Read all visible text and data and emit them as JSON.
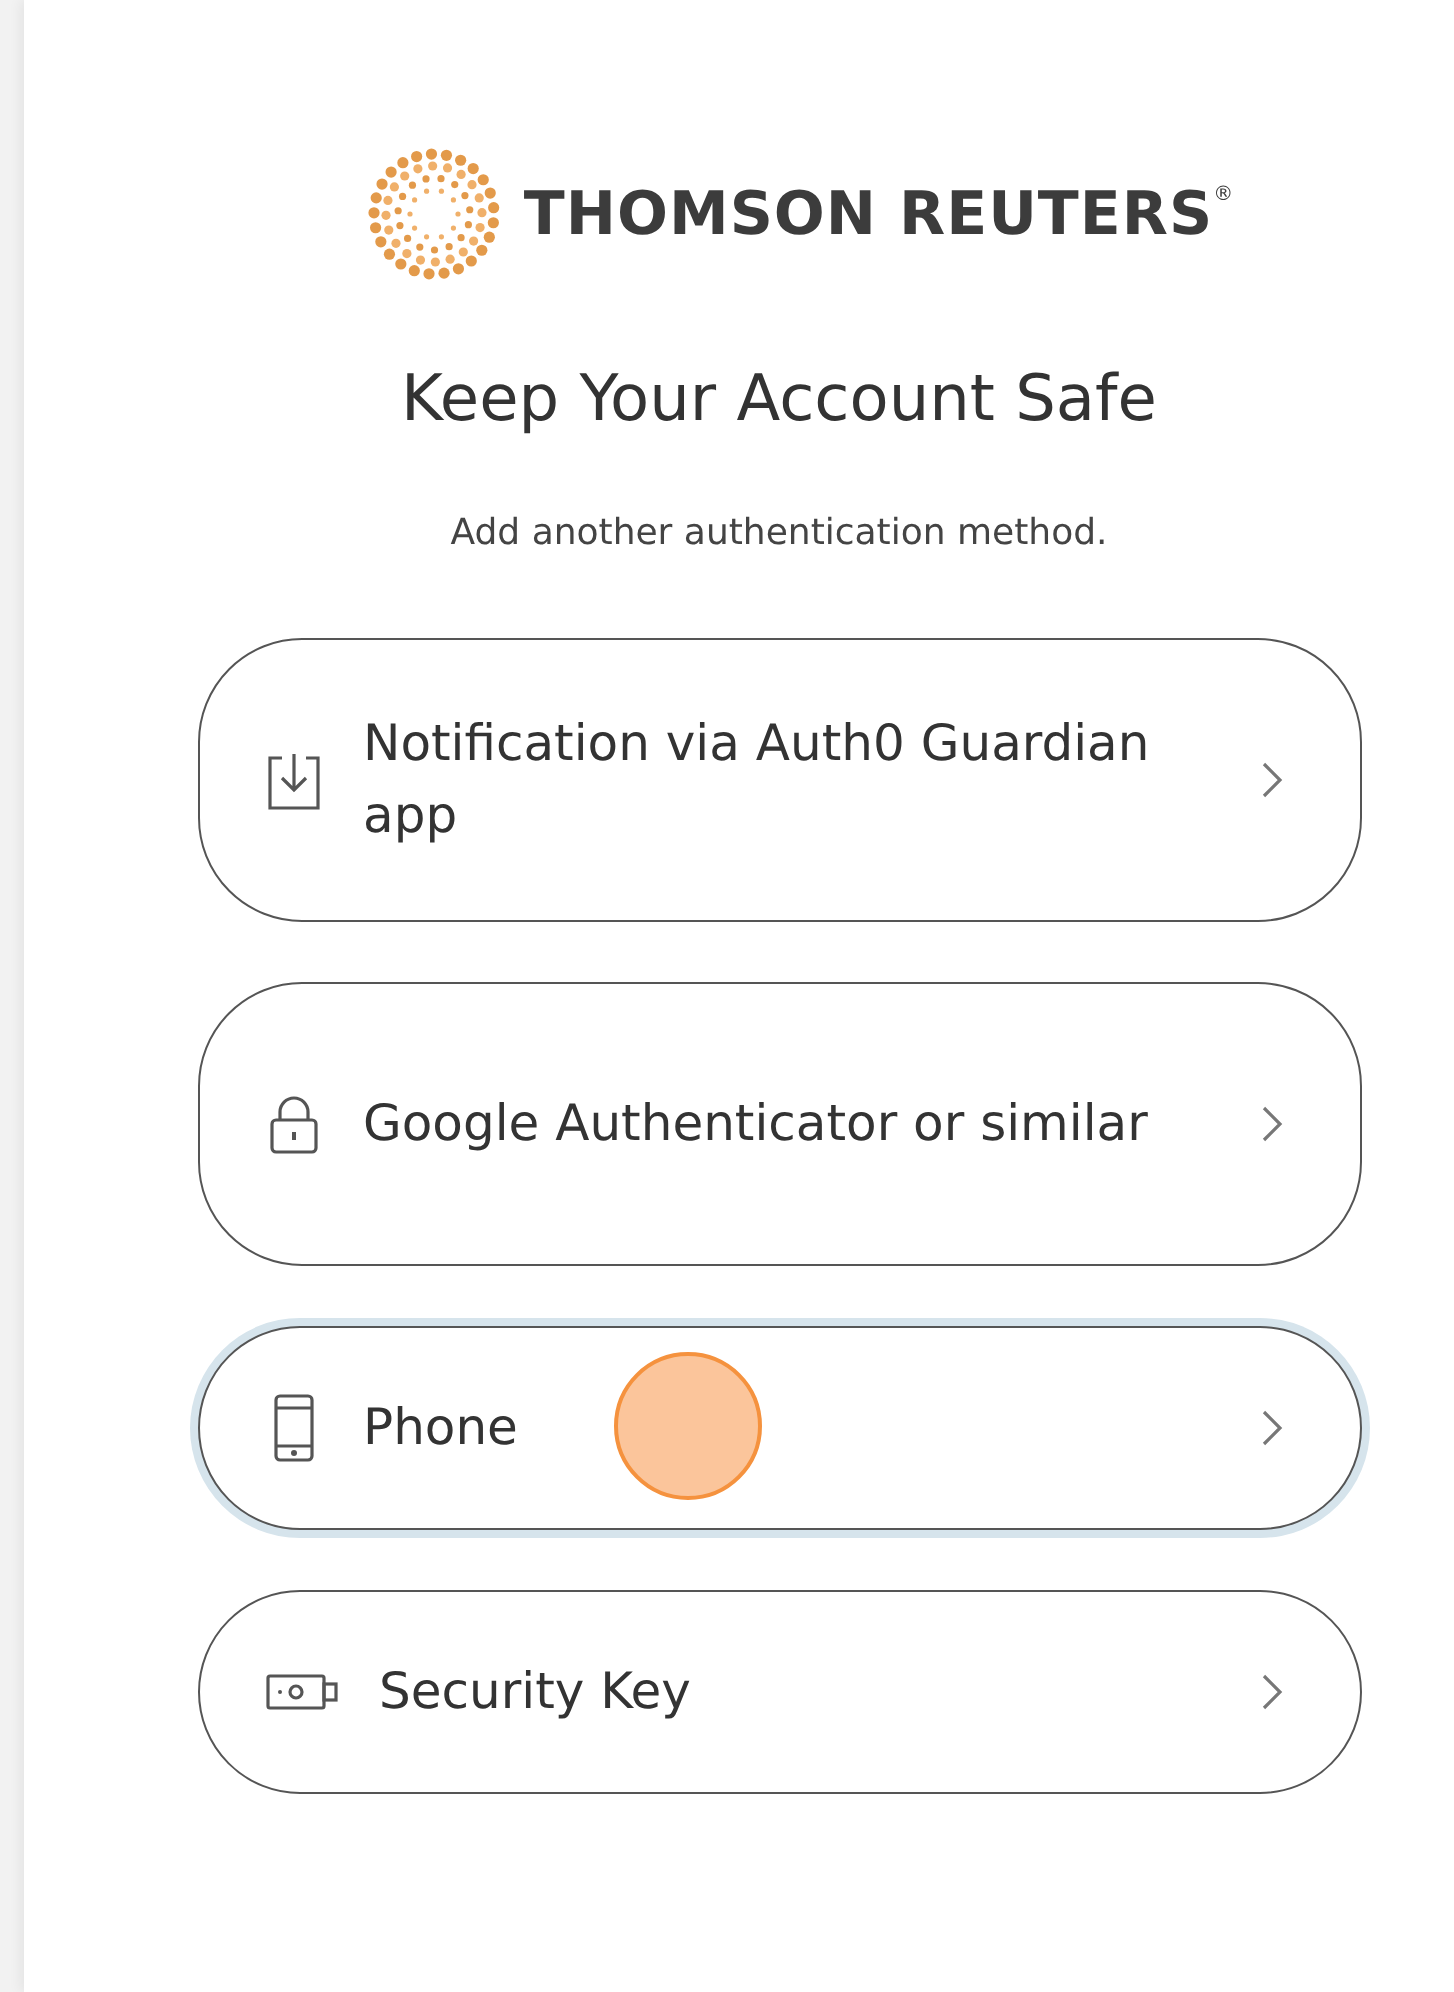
{
  "logo": {
    "text": "THOMSON REUTERS$^{®}$"
  },
  "title": "Keep Your Account Safe",
  "subtitle": "Add another authentication method.",
  "methods": [
    {
      "kind": "push",
      "label": "Notification via Auth0 Guardian app",
      "focused": false
    },
    {
      "kind": "otp",
      "label": "Google Authenticator or similar",
      "focused": false
    },
    {
      "kind": "phone",
      "label": "Phone",
      "focused": true
    },
    {
      "kind": "key",
      "label": "Security Key",
      "focused": false
    }
  ]
}
